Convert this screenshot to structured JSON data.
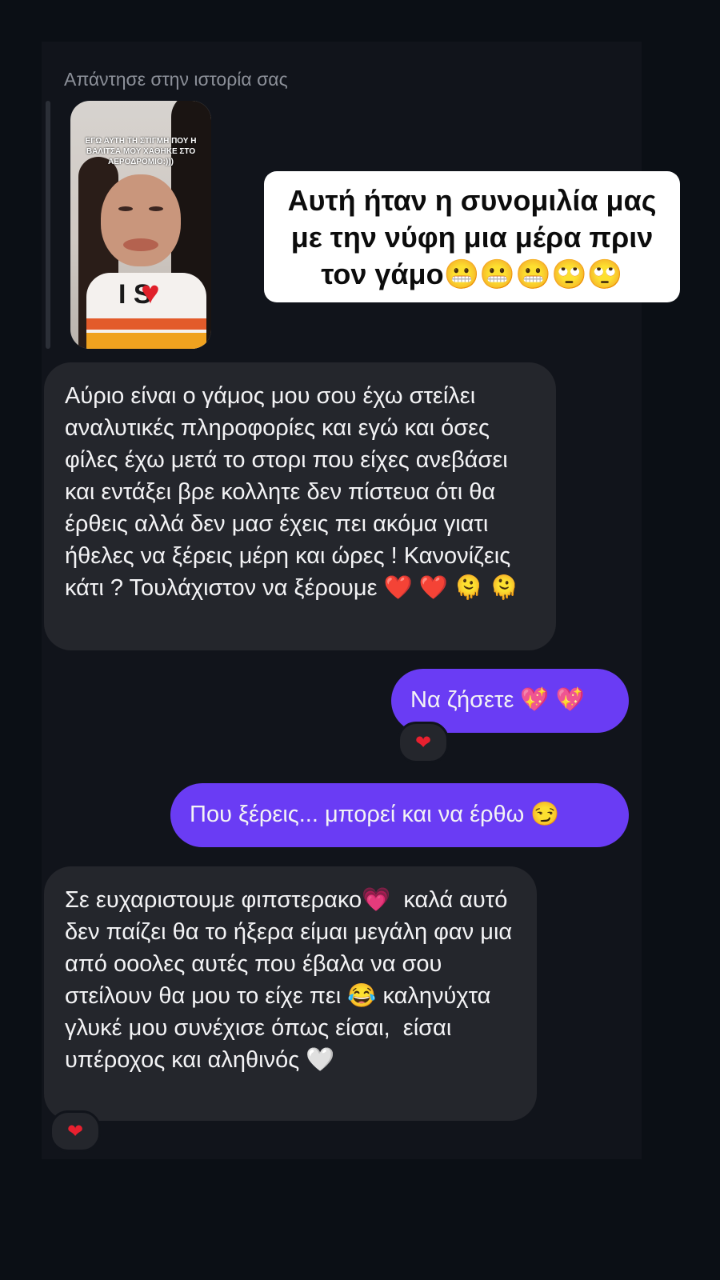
{
  "story_reply": {
    "caption": "Απάντησε στην ιστορία σας",
    "story_text": "ΕΓΩ ΑΥΤΗ ΤΗ ΣΤΙΓΜΗ ΠΟΥ Η ΒΑΛΙΤΣΑ ΜΟΥ ΧΑΘΗΚΕ ΣΤΟ ΑΕΡΟΔΡΟΜΙΟ:)))",
    "shirt_text": "I   S"
  },
  "overlay": {
    "text": "Αυτή ήταν η συνομιλία μας με την νύφη μια μέρα πριν τον γάμο😬😬😬🙄🙄"
  },
  "messages": [
    {
      "direction": "incoming",
      "text": "Αύριο είναι ο γάμος μου σου έχω στείλει αναλυτικές πληροφορίες και εγώ και όσες φίλες έχω μετά το στορι που είχες ανεβάσει και εντάξει βρε κολλητε δεν πίστευα ότι θα έρθεις αλλά δεν μασ έχεις πει ακόμα γιατι ήθελες να ξέρεις μέρη και ώρες ! Κανονίζεις κάτι ? Τουλάχιστον να ξέρουμε ❤️ ❤️ 🫠 🫠"
    },
    {
      "direction": "outgoing",
      "text": "Να ζήσετε 💖 💖",
      "reaction": "❤"
    },
    {
      "direction": "outgoing",
      "text": "Που ξέρεις... μπορεί και να έρθω 😏"
    },
    {
      "direction": "incoming",
      "text": "Σε ευχαριστουμε φιπστερακο💗  καλά αυτό δεν παίζει θα το ήξερα είμαι μεγάλη φαν μια από οοολες αυτές που έβαλα να σου στείλουν θα μου το είχε πει 😂 καληνύχτα γλυκέ μου συνέχισε όπως είσαι,  είσαι υπέροχος και αληθινός 🤍",
      "reaction": "❤"
    }
  ],
  "colors": {
    "background": "#0b0f15",
    "incoming_bubble": "#24262c",
    "outgoing_bubble": "#6a3cf4",
    "reaction_heart": "#e8202f"
  }
}
